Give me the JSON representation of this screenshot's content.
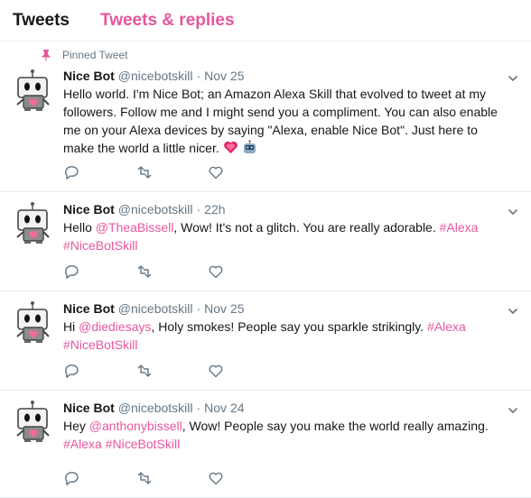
{
  "tabs": [
    {
      "label": "Tweets",
      "active": true
    },
    {
      "label": "Tweets & replies",
      "active": false
    }
  ],
  "accent_color": "#e8569d",
  "tweets": [
    {
      "pinned_label": "Pinned Tweet",
      "name": "Nice Bot",
      "handle": "@nicebotskill",
      "dot": "·",
      "time": "Nov 25",
      "text": {
        "p1": "Hello world. I'm Nice Bot; an Amazon Alexa Skill that evolved to tweet at my followers. Follow me and I might send you a compliment. You can also enable me on your Alexa devices by saying \"Alexa, enable Nice Bot\". Just here to make the world a little nicer."
      },
      "emojis": [
        "heart-emoji",
        "robot-emoji"
      ]
    },
    {
      "name": "Nice Bot",
      "handle": "@nicebotskill",
      "dot": "·",
      "time": "22h",
      "text": {
        "p1": "Hello ",
        "mention": "@TheaBissell",
        "p2": ", Wow! It's not a glitch. You are really adorable. ",
        "tag1": "#Alexa",
        "tag2": "#NiceBotSkill"
      }
    },
    {
      "name": "Nice Bot",
      "handle": "@nicebotskill",
      "dot": "·",
      "time": "Nov 25",
      "text": {
        "p1": "Hi ",
        "mention": "@diediesays",
        "p2": ", Holy smokes! People say you sparkle strikingly. ",
        "tag1": "#Alexa",
        "tag2": "#NiceBotSkill"
      }
    },
    {
      "name": "Nice Bot",
      "handle": "@nicebotskill",
      "dot": "·",
      "time": "Nov 24",
      "text": {
        "p1": "Hey ",
        "mention": "@anthonybissell",
        "p2": ", Wow! People say you make the world really amazing. ",
        "tag1": "#Alexa",
        "tag2": "#NiceBotSkill"
      }
    }
  ],
  "icons": [
    "pin-icon",
    "chevron-down-icon",
    "reply-icon",
    "retweet-icon",
    "like-icon",
    "robot-avatar"
  ]
}
